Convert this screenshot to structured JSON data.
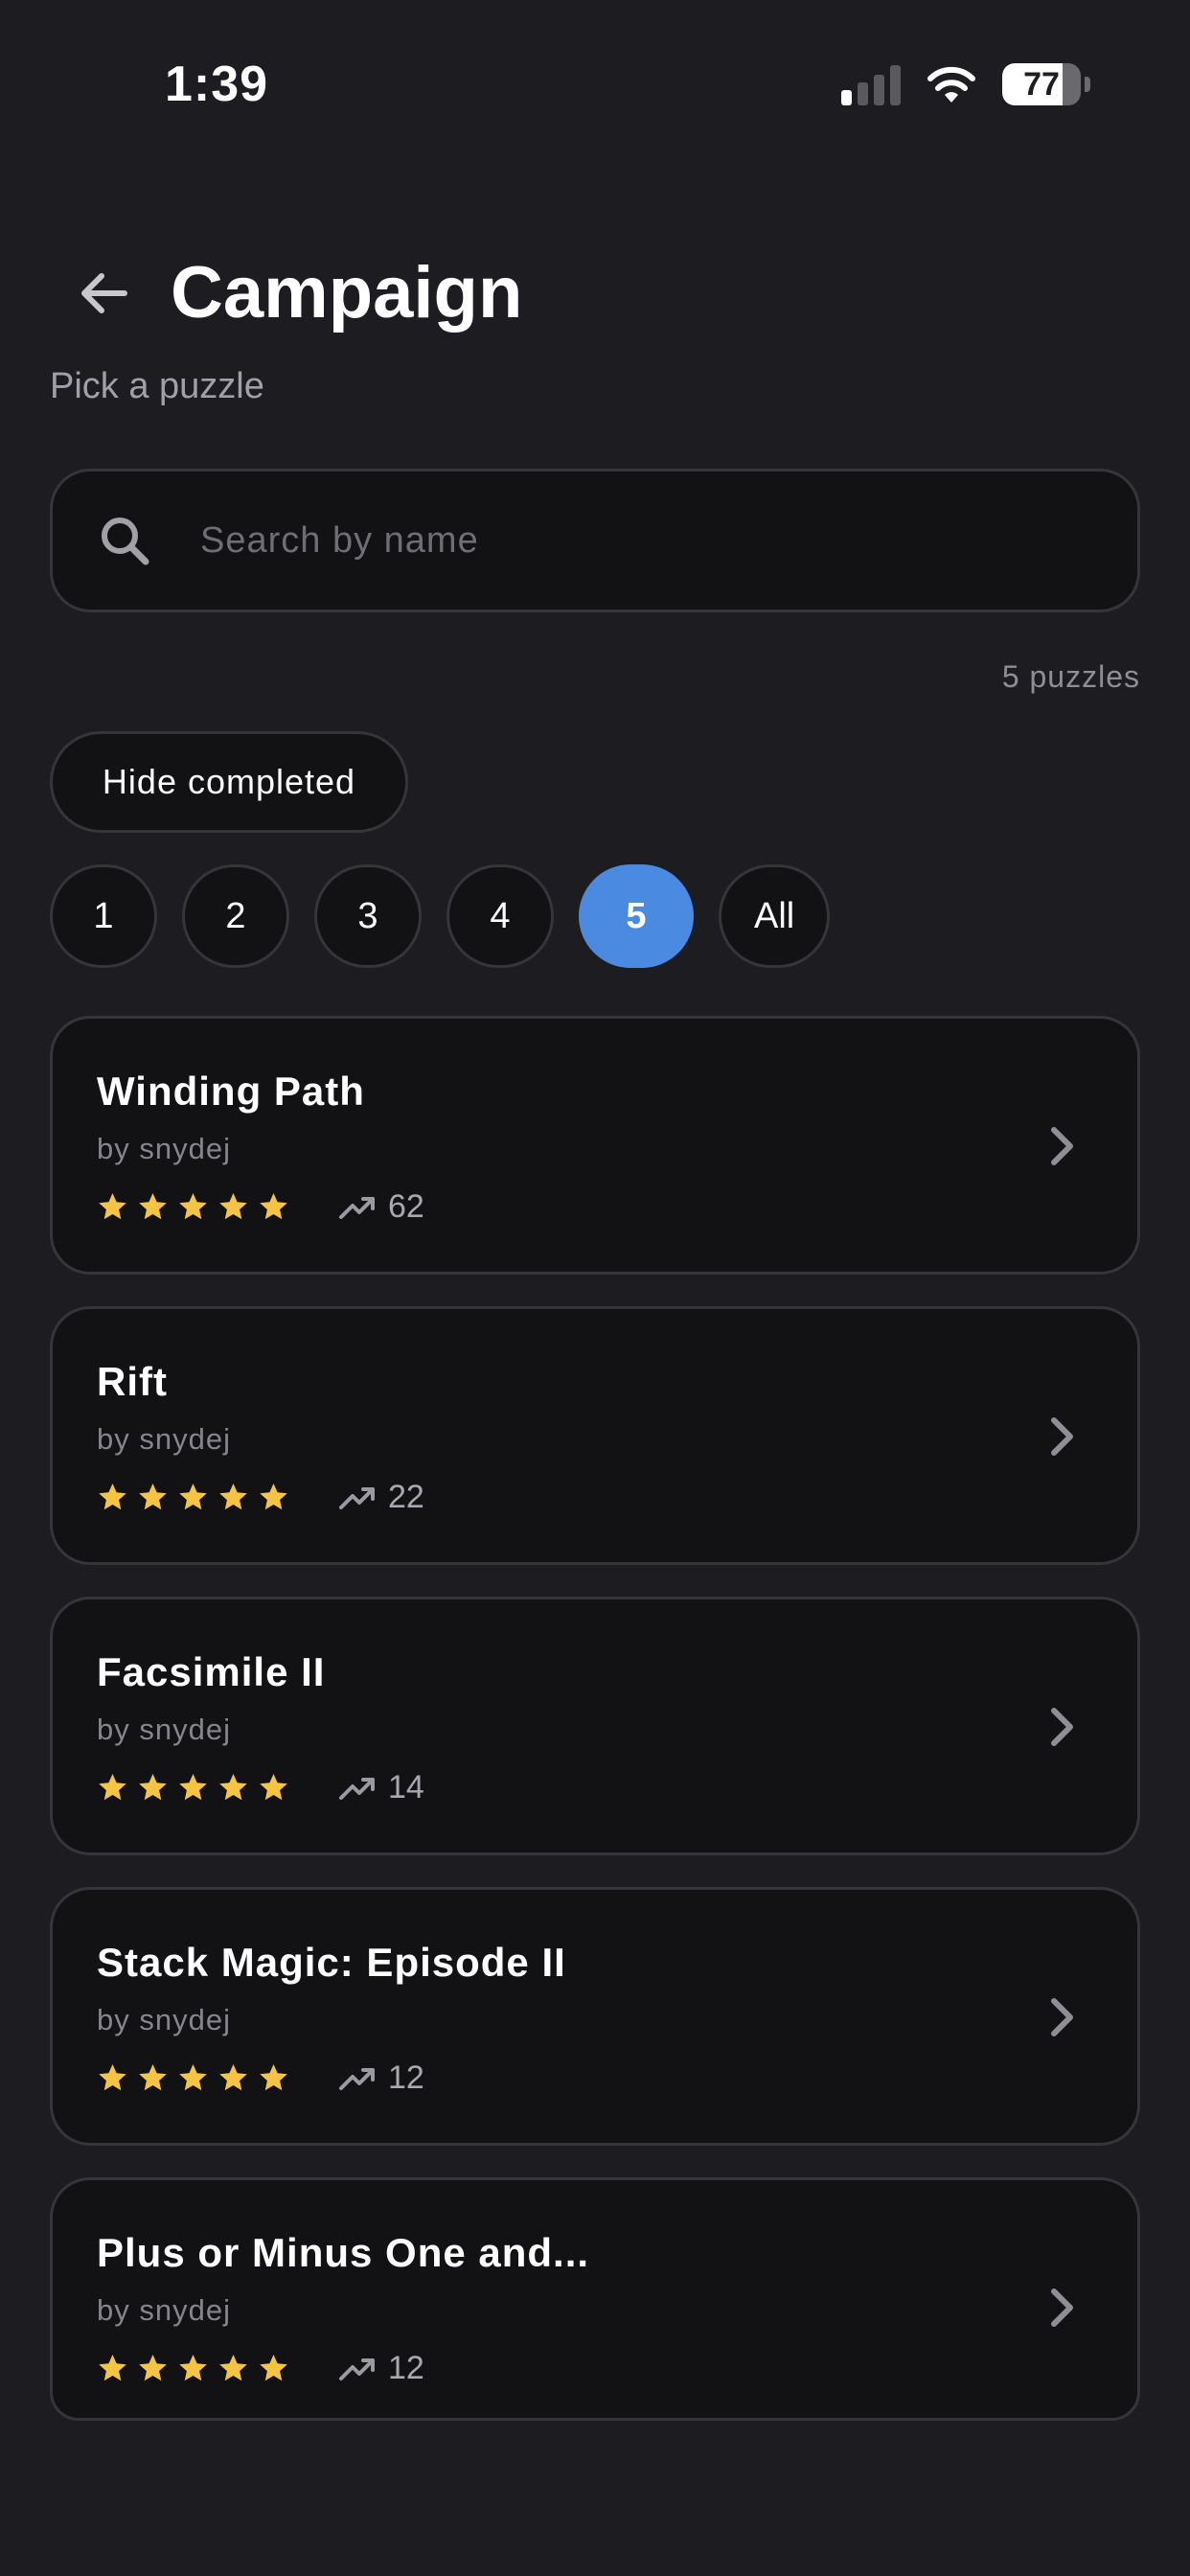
{
  "status_bar": {
    "time": "1:39",
    "battery": "77",
    "battery_level": 0.77
  },
  "header": {
    "title": "Campaign",
    "subtitle": "Pick a puzzle"
  },
  "search": {
    "placeholder": "Search by name",
    "value": ""
  },
  "puzzle_count": "5 puzzles",
  "filters": {
    "hide_completed_label": "Hide completed",
    "levels": [
      "1",
      "2",
      "3",
      "4",
      "5",
      "All"
    ],
    "selected_level": "5"
  },
  "colors": {
    "background": "#1c1c21",
    "card": "#121214",
    "accent": "#4a8ae0",
    "star": "#f5c443"
  },
  "icons": {
    "back": "arrow-left-icon",
    "search": "search-icon",
    "plays": "trending-up-icon",
    "open": "chevron-right-icon",
    "rating": "star-icon"
  },
  "puzzles": [
    {
      "title": "Winding Path",
      "author": "by snydej",
      "rating": 5,
      "plays": "62"
    },
    {
      "title": "Rift",
      "author": "by snydej",
      "rating": 5,
      "plays": "22"
    },
    {
      "title": "Facsimile II",
      "author": "by snydej",
      "rating": 5,
      "plays": "14"
    },
    {
      "title": "Stack Magic: Episode II",
      "author": "by snydej",
      "rating": 5,
      "plays": "12"
    },
    {
      "title": "Plus or Minus One and...",
      "author": "by snydej",
      "rating": 5,
      "plays": "12"
    }
  ]
}
